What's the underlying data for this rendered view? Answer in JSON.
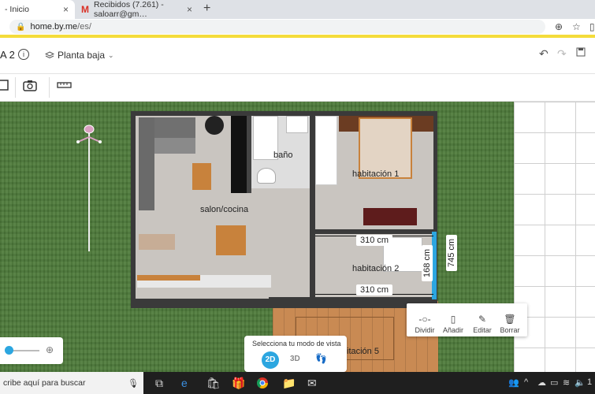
{
  "browser": {
    "tabs": [
      {
        "label": "- Inicio",
        "close": "×"
      },
      {
        "label": "Recibidos (7.261) - saloarr@gm…",
        "icon": "M",
        "close": "×"
      }
    ],
    "new_tab": "+",
    "url_host": "home.by.me",
    "url_path": "/es/"
  },
  "app": {
    "project_name": "A 2",
    "info_icon": "i",
    "floor_selector": "Planta baja",
    "floor_icon": "layers-icon",
    "undo": "↶",
    "redo": "↷",
    "save": "💾"
  },
  "plan": {
    "rooms": {
      "salon": "salon/cocina",
      "bano": "baño",
      "hab1": "habitación 1",
      "hab2": "habitación 2",
      "hab5": "itación 5"
    },
    "measures": {
      "top_width": "310 cm",
      "bottom_width": "310 cm",
      "height_inner": "168 cm",
      "height_outer": "745 cm"
    }
  },
  "context_menu": {
    "dividir": "Dividir",
    "anadir": "Añadir",
    "editar": "Editar",
    "borrar": "Borrar"
  },
  "view_mode": {
    "title": "Selecciona tu modo de vista",
    "btn_2d": "2D",
    "btn_3d": "3D"
  },
  "taskbar": {
    "search": "cribe aquí para buscar",
    "clock": "1"
  },
  "colors": {
    "accent": "#2ca6e0",
    "grass": "#4d7a3a",
    "yellow_bar": "#f4dc3a",
    "terrace": "#c98a53"
  }
}
